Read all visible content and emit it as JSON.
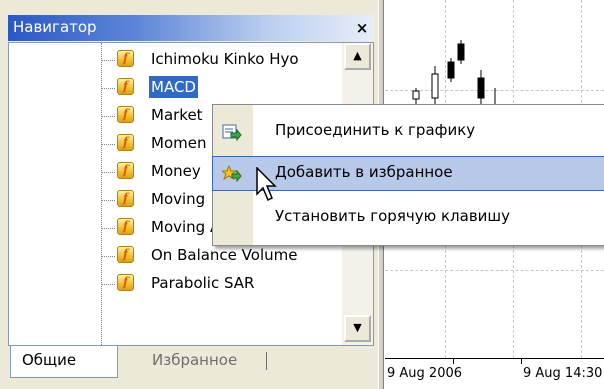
{
  "navigator": {
    "title": "Навигатор",
    "close_label": "×",
    "items": [
      {
        "label": "Ichimoku Kinko Hyo",
        "icon": "custom-indicator-icon",
        "selected": false
      },
      {
        "label": "MACD",
        "icon": "custom-indicator-icon",
        "selected": true
      },
      {
        "label": "Market",
        "icon": "custom-indicator-icon",
        "selected": false
      },
      {
        "label": "Momen",
        "icon": "custom-indicator-icon",
        "selected": false
      },
      {
        "label": "Money",
        "icon": "custom-indicator-icon",
        "selected": false
      },
      {
        "label": "Moving",
        "icon": "custom-indicator-icon",
        "selected": false
      },
      {
        "label": "Moving Average of C",
        "icon": "custom-indicator-icon",
        "selected": false
      },
      {
        "label": "On Balance Volume",
        "icon": "custom-indicator-icon",
        "selected": false
      },
      {
        "label": "Parabolic SAR",
        "icon": "custom-indicator-icon",
        "selected": false
      }
    ],
    "icon_glyph": "f",
    "scroll_up": "▲",
    "scroll_down": "▼",
    "tabs": {
      "general": "Общие",
      "favorites": "Избранное"
    }
  },
  "context_menu": {
    "items": [
      {
        "label": "Присоединить к графику",
        "icon": "attach-to-chart-icon",
        "hover": false
      },
      {
        "label": "Добавить в избранное",
        "icon": "add-to-favorites-icon",
        "hover": true
      },
      {
        "label": "Установить горячую клавишу",
        "icon": "",
        "hover": false
      }
    ]
  },
  "chart": {
    "time_labels": [
      "9 Aug 2006",
      "9 Aug 14:30"
    ]
  },
  "colors": {
    "selection": "#316ac5",
    "title_gradient_start": "#2a58c6",
    "menu_hover": "#b8c8e8"
  }
}
